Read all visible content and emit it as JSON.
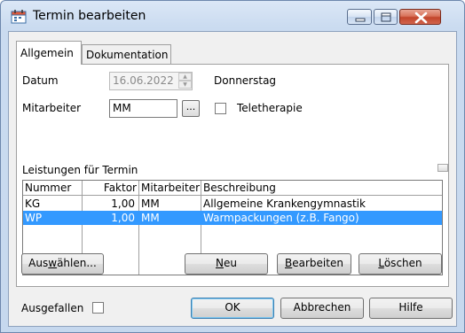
{
  "window": {
    "title": "Termin bearbeiten",
    "icon": "calendar-icon"
  },
  "tabs": [
    {
      "label": "Allgemein",
      "active": true
    },
    {
      "label": "Dokumentation",
      "active": false
    }
  ],
  "form": {
    "datum_label": "Datum",
    "datum_value": "16.06.2022",
    "weekday": "Donnerstag",
    "mitarbeiter_label": "Mitarbeiter",
    "mitarbeiter_value": "MM",
    "browse_label": "...",
    "teletherapie_label": "Teletherapie",
    "teletherapie_checked": false
  },
  "leistungen": {
    "title": "Leistungen für Termin",
    "columns": [
      "Nummer",
      "Faktor",
      "Mitarbeiter",
      "Beschreibung"
    ],
    "rows": [
      {
        "nummer": "KG",
        "faktor": "1,00",
        "mitarbeiter": "MM",
        "beschreibung": "Allgemeine Krankengymnastik",
        "selected": false
      },
      {
        "nummer": "WP",
        "faktor": "1,00",
        "mitarbeiter": "MM",
        "beschreibung": "Warmpackungen (z.B. Fango)",
        "selected": true
      }
    ]
  },
  "panel_buttons": {
    "auswaehlen_pre": "Aus",
    "auswaehlen_ul": "w",
    "auswaehlen_post": "ählen...",
    "neu_ul": "N",
    "neu_post": "eu",
    "bearbeiten_ul": "B",
    "bearbeiten_post": "earbeiten",
    "loeschen_ul": "L",
    "loeschen_post": "öschen"
  },
  "footer": {
    "ausgefallen_label": "Ausgefallen",
    "ausgefallen_checked": false,
    "ok_label": "OK",
    "abbrechen_label": "Abbrechen",
    "hilfe_label": "Hilfe"
  },
  "colors": {
    "selection": "#3399ff",
    "title_bar": "#cadbf0",
    "close_button": "#c2452b"
  }
}
